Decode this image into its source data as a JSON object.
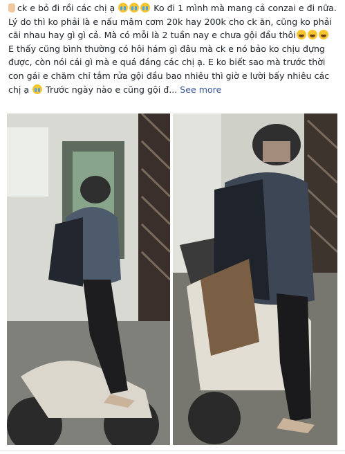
{
  "post": {
    "line1_text": "ck e bỏ đi rồi các chị ạ",
    "line1_text_after": "Ko đi 1 mình mà mang cả conzai e đi nữa.",
    "paragraph2": "Lý do thì ko phải là e nấu mâm cơm 20k hay 200k cho ck ăn, cũng ko phải cãi nhau hay gì gì cả. Mà có mỗi là 2 tuần nay e chưa gội đầu thôi",
    "paragraph3": "E thấy cũng bình thường có hôi hám gì đâu mà ck e nó bảo ko chịu đựng được, còn nói cái gì mà e quá đáng các chị ạ. E ko biết sao mà trước thời con gái e chăm chỉ tắm rửa gội đầu bao nhiêu thì giờ e lười bấy nhiêu các chị ạ",
    "paragraph3_end": "Trước ngày nào e cũng gội đ...",
    "see_more": "See more"
  },
  "icons": {
    "pointing_hand": "pointing-hand-icon",
    "crying": "crying-face-icon",
    "laughing": "laughing-face-icon"
  },
  "colors": {
    "link": "#385898",
    "text": "#1d2129",
    "emoji": "#f7c531"
  }
}
